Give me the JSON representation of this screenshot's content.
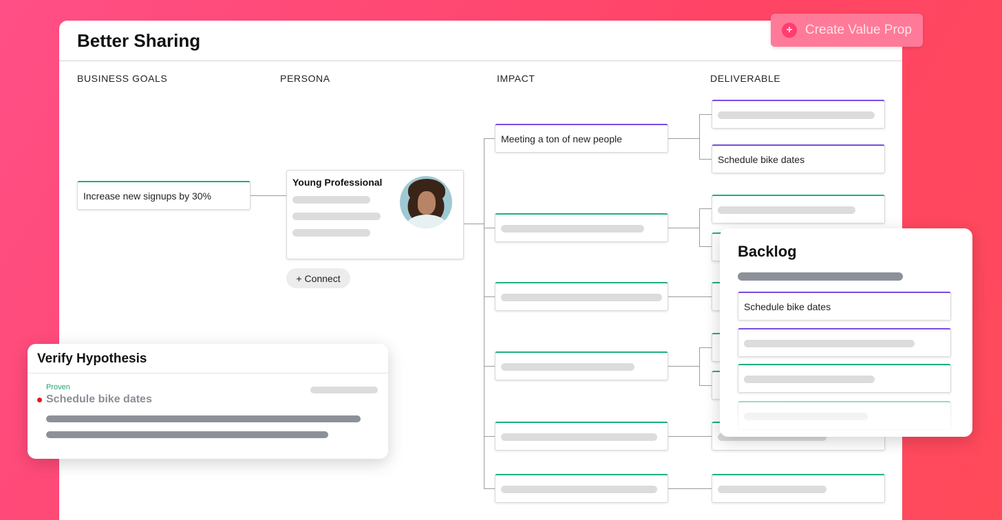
{
  "board": {
    "title": "Better Sharing",
    "columns": [
      "BUSINESS GOALS",
      "PERSONA",
      "IMPACT",
      "DELIVERABLE"
    ],
    "create_button": "Create Value Prop",
    "goal": "Increase new signups by 30%",
    "persona": "Young Professional",
    "connect": "+ Connect",
    "impact_first": "Meeting a ton of new people",
    "deliverable_second": "Schedule bike dates"
  },
  "verify": {
    "title": "Verify Hypothesis",
    "status": "Proven",
    "item": "Schedule bike dates"
  },
  "backlog": {
    "title": "Backlog",
    "first_item": "Schedule bike dates"
  },
  "colors": {
    "accent_green": "#1fb07a",
    "accent_purple": "#7b4be0",
    "brand_pink": "#ff4466"
  }
}
